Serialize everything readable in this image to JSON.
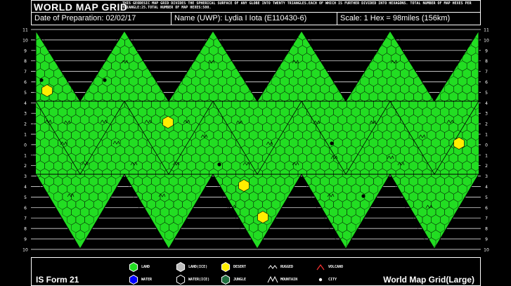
{
  "title": "WORLD MAP GRID",
  "description": "THIS GEODESIC MAP GRID DIVIDES THE SPHERICAL SURFACE OF ANY GLOBE INTO TWENTY TRIANGLES.EACH OF WHICH IS FURTHER DIVIDED INTO HEXAGONS. TOTAL NUMBER OF MAP HEXES PER TRIANGLE:25.TOTAL NUMBER OF MAP HEXES:500.",
  "info": {
    "date": "Date of Preparation: 02/02/17",
    "name": "Name (UWP): Lydia I Iota (E110430-6)",
    "scale": "Scale: 1 Hex = 98miles (156km)"
  },
  "row_labels": [
    "11",
    "10",
    "9",
    "8",
    "7",
    "6",
    "5",
    "4",
    "3",
    "2",
    "1",
    "0",
    "1",
    "2",
    "3",
    "4",
    "5",
    "6",
    "7",
    "8",
    "9",
    "10",
    "11"
  ],
  "legend": [
    {
      "key": "land",
      "label": "LAND",
      "icon": "hex",
      "color": "#22dd22"
    },
    {
      "key": "land-ice",
      "label": "LAND(ICE)",
      "icon": "hex",
      "color": "#bbbbbb"
    },
    {
      "key": "desert",
      "label": "DESERT",
      "icon": "hex",
      "color": "#ffee00"
    },
    {
      "key": "rugged",
      "label": "RUGGED",
      "icon": "rugged"
    },
    {
      "key": "volcano",
      "label": "VOLCANO",
      "icon": "volcano",
      "color": "#ff3333"
    },
    {
      "key": "water",
      "label": "WATER",
      "icon": "hex",
      "color": "#0000ff"
    },
    {
      "key": "water-ice",
      "label": "WATER(ICE)",
      "icon": "hex",
      "color": "#000000"
    },
    {
      "key": "jungle",
      "label": "JUNGLE",
      "icon": "hex",
      "color": "#207040"
    },
    {
      "key": "mountain",
      "label": "MOUNTAIN",
      "icon": "mountain"
    },
    {
      "key": "city",
      "label": "CITY",
      "icon": "dot"
    }
  ],
  "form_label": "IS Form 21",
  "grid_name": "World Map Grid(Large)",
  "colors": {
    "land": "#22dd22",
    "desert": "#ffee00",
    "line": "#000000"
  }
}
